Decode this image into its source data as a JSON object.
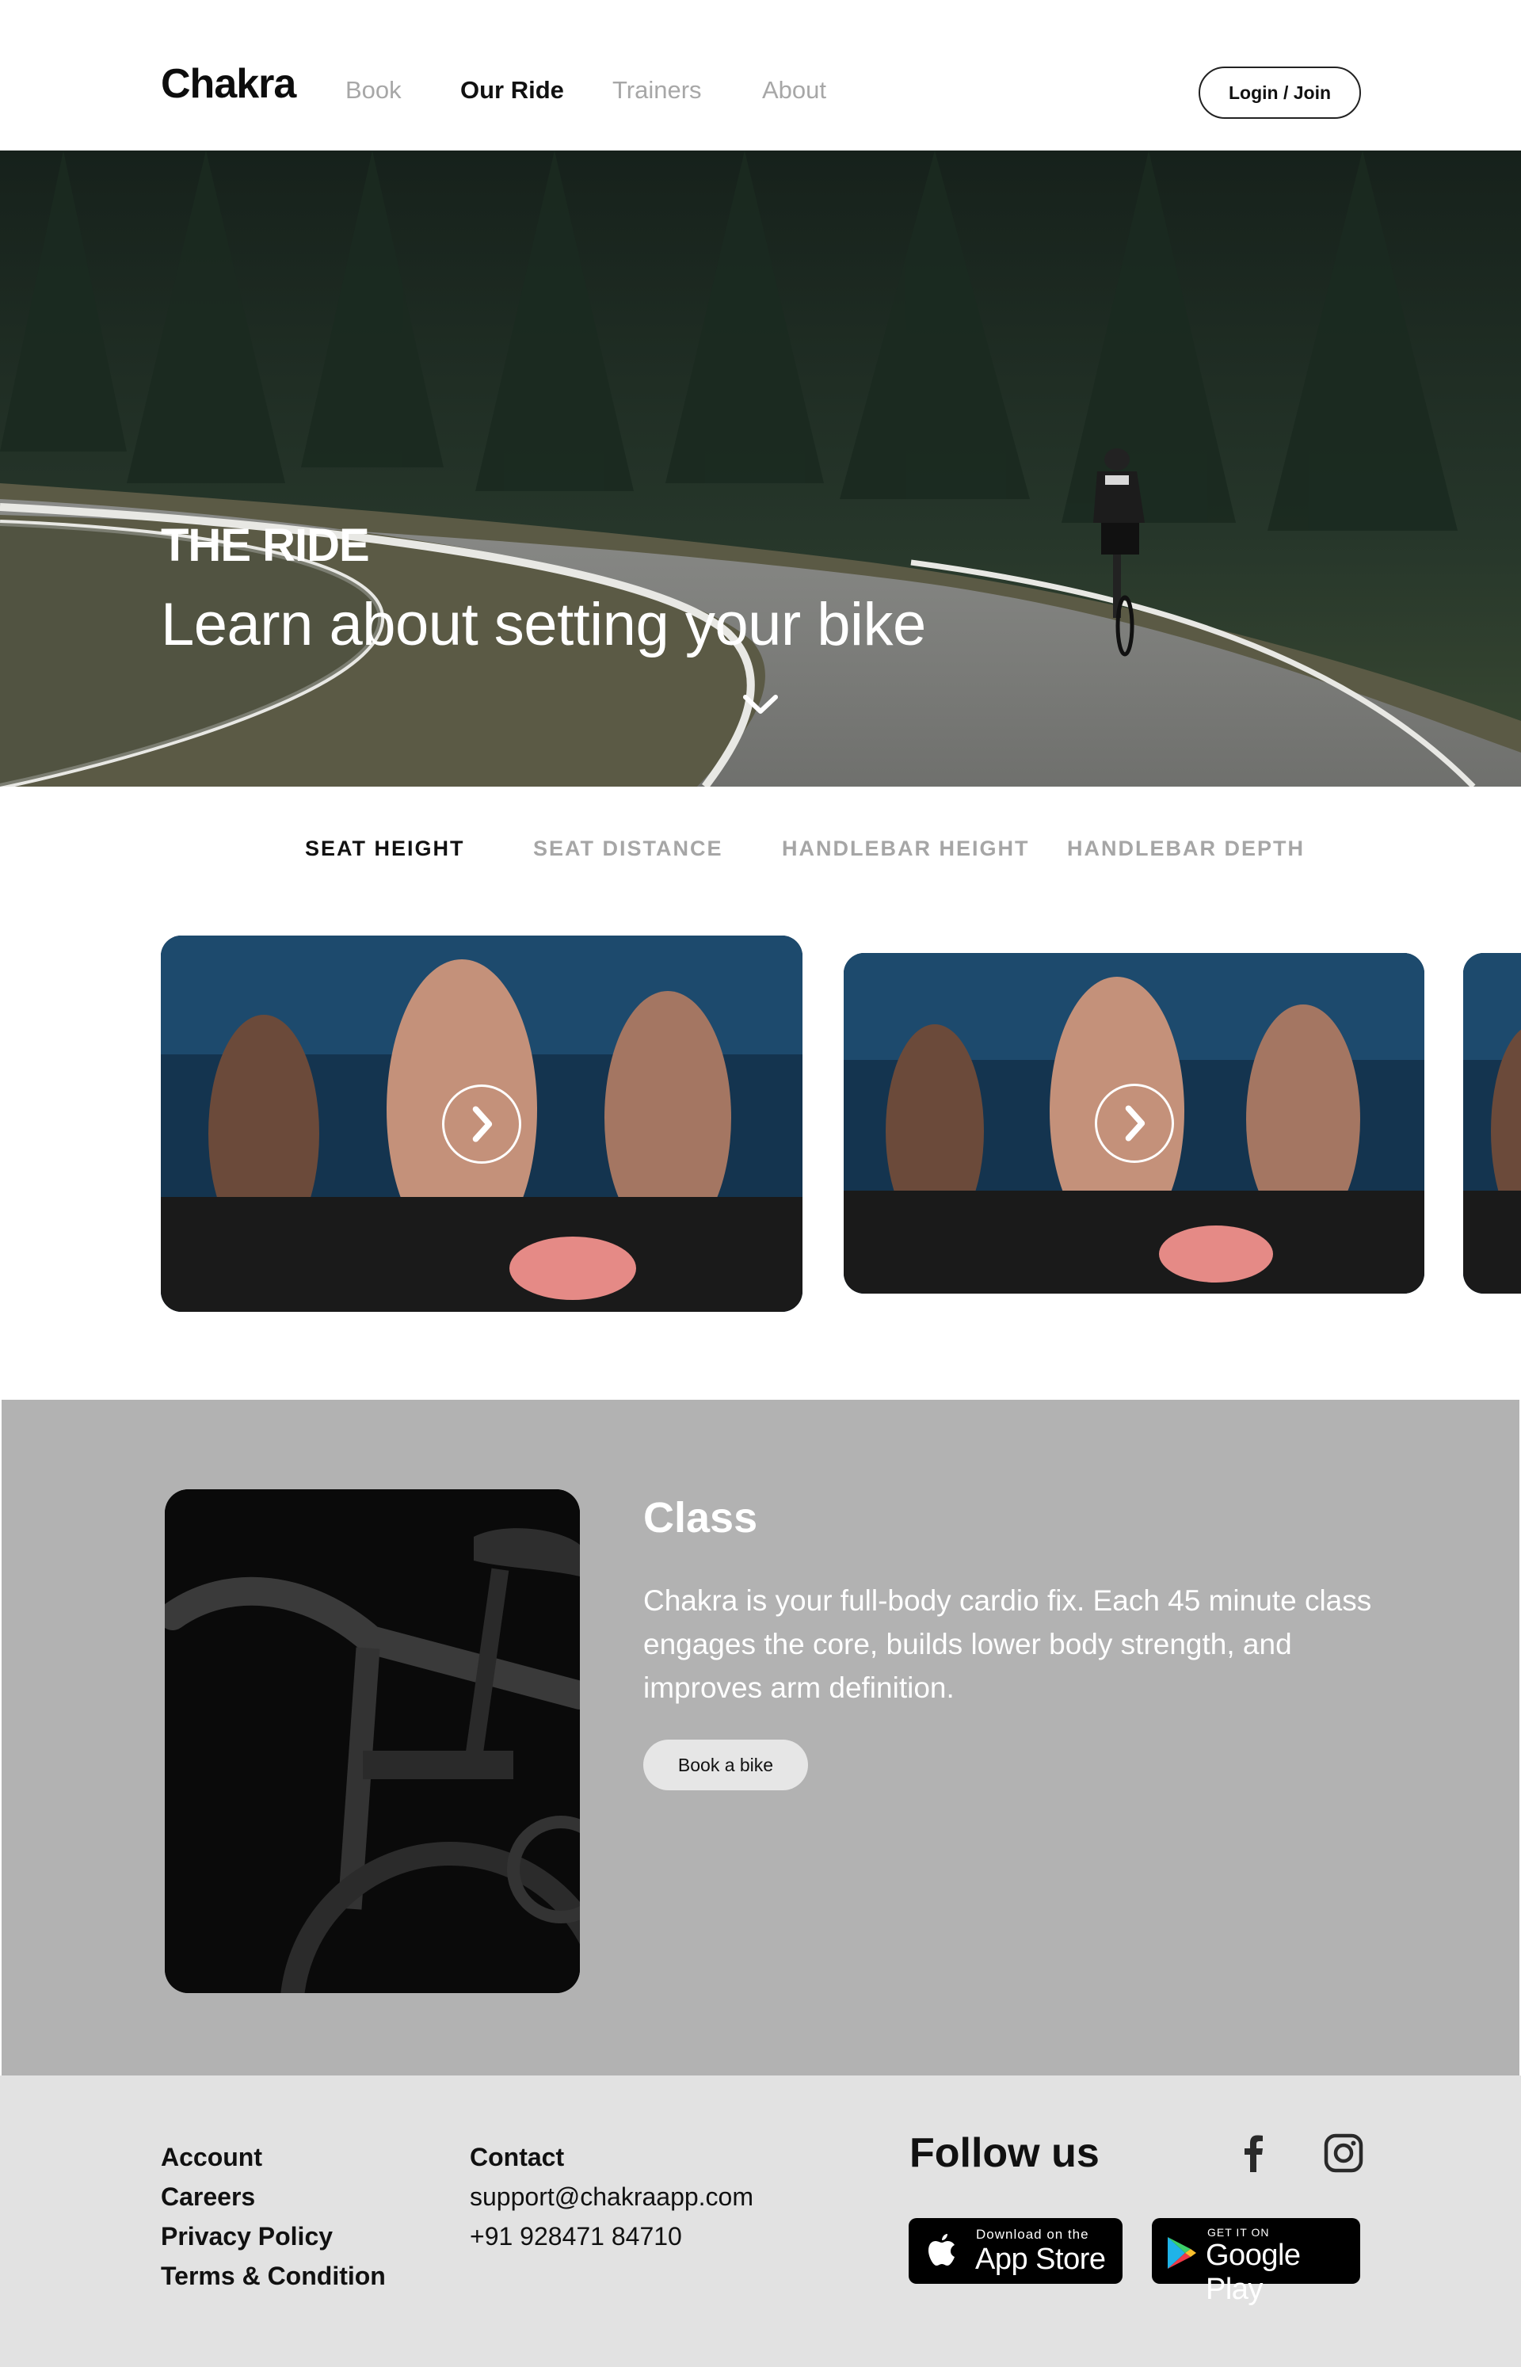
{
  "header": {
    "logo": "Chakra",
    "nav": [
      {
        "label": "Book",
        "active": false
      },
      {
        "label": "Our Ride",
        "active": true
      },
      {
        "label": "Trainers",
        "active": false
      },
      {
        "label": "About",
        "active": false
      }
    ],
    "login_label": "Login / Join"
  },
  "hero": {
    "kicker": "THE RIDE",
    "title": "Learn about setting your bike",
    "scroll_icon": "chevron-down-icon"
  },
  "tabs": [
    {
      "label": "SEAT HEIGHT",
      "active": true
    },
    {
      "label": "SEAT DISTANCE",
      "active": false
    },
    {
      "label": "HANDLEBAR HEIGHT",
      "active": false
    },
    {
      "label": "HANDLEBAR DEPTH",
      "active": false
    }
  ],
  "videos": [
    {
      "icon": "play-icon"
    },
    {
      "icon": "play-icon"
    },
    {
      "icon": "play-icon"
    }
  ],
  "class_section": {
    "title": "Class",
    "description": "Chakra is your full-body cardio fix. Each 45 minute class engages the core, builds lower body strength, and improves arm definition.",
    "button_label": "Book a bike"
  },
  "footer": {
    "links": [
      "Account",
      "Careers",
      "Privacy Policy",
      "Terms & Condition"
    ],
    "contact": {
      "heading": "Contact",
      "email": "support@chakraapp.com",
      "phone": "+91 928471 84710"
    },
    "follow_us": "Follow us",
    "social": [
      "facebook-icon",
      "instagram-icon"
    ],
    "app_store": {
      "small": "Download on the",
      "big": "App Store"
    },
    "google_play": {
      "small": "GET IT ON",
      "big": "Google Play"
    }
  },
  "colors": {
    "class_bg": "#b2b2b2",
    "footer_bg": "#e2e2e2",
    "nav_inactive": "#a7a7a7"
  }
}
